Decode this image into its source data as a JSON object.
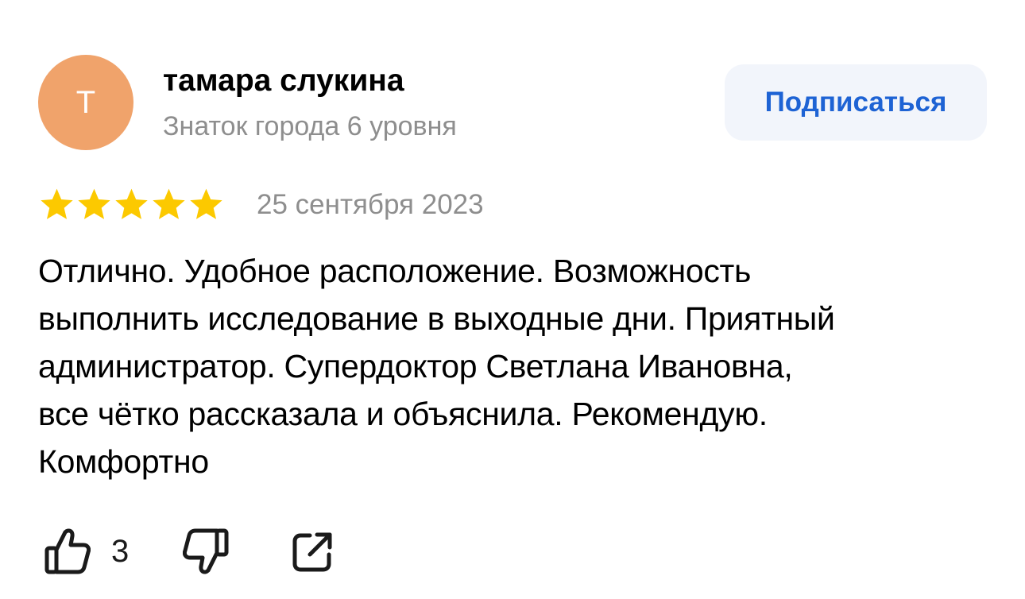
{
  "colors": {
    "avatar_bg": "#f0a36b",
    "star": "#fcc900",
    "subscribe_bg": "#f2f5fb",
    "subscribe_text": "#1e63d4",
    "secondary_text": "#8e8e8e",
    "icon_stroke": "#1a1a1a"
  },
  "author": {
    "avatar_letter": "T",
    "name": "тамара слукина",
    "level": "Знаток города 6 уровня"
  },
  "subscribe_label": "Подписаться",
  "review": {
    "rating": 5,
    "rating_max": 5,
    "date": "25 сентября 2023",
    "text_lines": [
      "Отлично. Удобное расположение. Возможность",
      "выполнить исследование в выходные дни. Приятный",
      "администратор. Супердоктор Светлана Ивановна,",
      "все чётко рассказала и объяснила. Рекомендую.",
      "Комфортно"
    ]
  },
  "actions": {
    "like_icon": "thumbs-up-icon",
    "like_count": "3",
    "dislike_icon": "thumbs-down-icon",
    "share_icon": "share-icon"
  }
}
